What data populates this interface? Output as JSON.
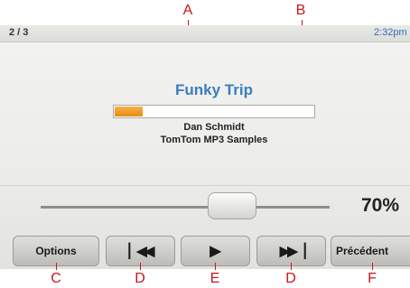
{
  "status_bar": {
    "track_position": "2 / 3",
    "time": "2:32pm"
  },
  "now_playing": {
    "title": "Funky Trip",
    "artist": "Dan Schmidt",
    "album": "TomTom MP3 Samples",
    "playback_progress": 0.14
  },
  "volume": {
    "level": 0.7,
    "text": "70%"
  },
  "buttons": {
    "options_label": "Options",
    "previous_icon": "skip-previous-icon",
    "play_icon": "play-icon",
    "next_icon": "skip-next-icon",
    "back_label": "Précédent"
  },
  "callouts": {
    "A": "A",
    "B": "B",
    "C": "C",
    "D": "D",
    "E": "E",
    "F": "F"
  },
  "colors": {
    "title_blue": "#3b7dc0",
    "progress_orange": "#e98a12",
    "callout_red": "#c8151b",
    "time_blue": "#2f6fb3"
  }
}
